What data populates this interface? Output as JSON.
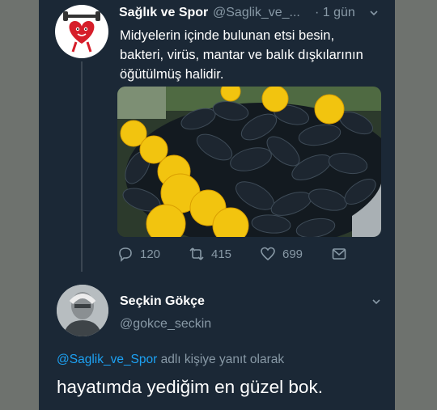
{
  "tweet": {
    "author_name": "Sağlık ve Spor",
    "author_handle": "@Saglik_ve_...",
    "time": "· 1 gün",
    "text_lines": [
      "Midyelerin içinde bulunan etsi besin,",
      "bakteri, virüs, mantar ve balık dışkılarının",
      "öğütülmüş halidir."
    ],
    "stats": {
      "replies": "120",
      "retweets": "415",
      "likes": "699"
    }
  },
  "reply": {
    "author_name": "Seçkin Gökçe",
    "author_handle": "@gokce_seckin",
    "reply_to_mention": "@Saglik_ve_Spor",
    "reply_to_suffix": " adlı kişiye yanıt olarak",
    "text": "hayatımda yediğim en güzel bok."
  },
  "icons": {
    "reply": "reply-bubble-icon",
    "retweet": "retweet-icon",
    "like": "heart-icon",
    "share": "share-envelope-icon",
    "caret": "chevron-down-icon"
  },
  "colors": {
    "background": "#1b2836",
    "text": "#ffffff",
    "muted": "#8899a6",
    "link": "#1da1f2"
  }
}
